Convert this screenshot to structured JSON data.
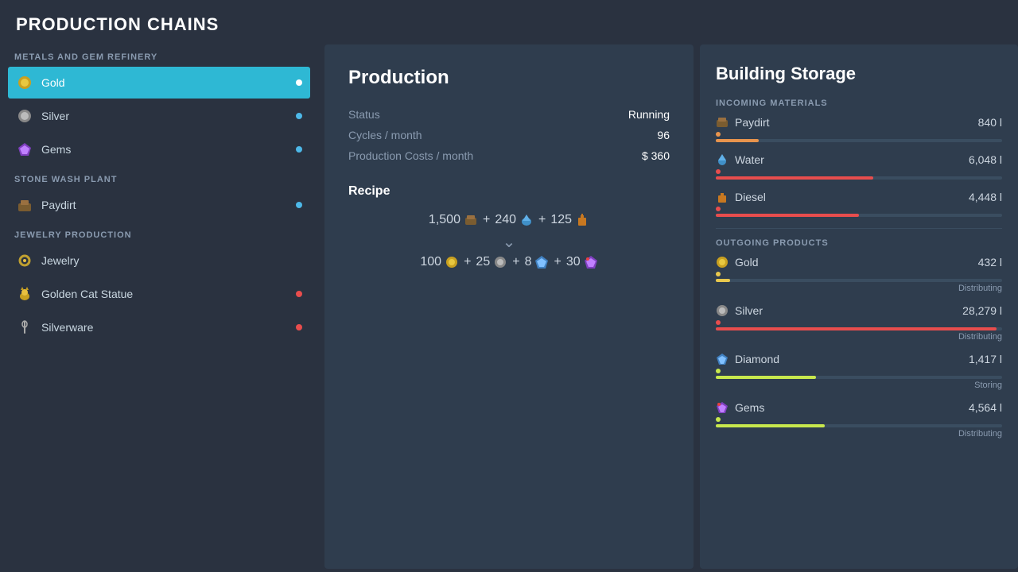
{
  "page": {
    "title": "PRODUCTION CHAINS"
  },
  "leftPanel": {
    "sections": [
      {
        "header": "METALS AND GEM REFINERY",
        "items": [
          {
            "id": "gold",
            "label": "Gold",
            "icon": "⛏️",
            "dot": "white",
            "active": true
          },
          {
            "id": "silver",
            "label": "Silver",
            "icon": "⛏️",
            "dot": "blue",
            "active": false
          },
          {
            "id": "gems",
            "label": "Gems",
            "icon": "💎",
            "dot": "blue",
            "active": false
          }
        ]
      },
      {
        "header": "STONE WASH PLANT",
        "items": [
          {
            "id": "paydirt",
            "label": "Paydirt",
            "icon": "🪨",
            "dot": "blue",
            "active": false
          }
        ]
      },
      {
        "header": "JEWELRY PRODUCTION",
        "items": [
          {
            "id": "jewelry",
            "label": "Jewelry",
            "icon": "💍",
            "dot": "none",
            "active": false
          },
          {
            "id": "golden-cat",
            "label": "Golden Cat Statue",
            "icon": "🐱",
            "dot": "red",
            "active": false
          },
          {
            "id": "silverware",
            "label": "Silverware",
            "icon": "🍴",
            "dot": "red",
            "active": false
          }
        ]
      }
    ]
  },
  "middlePanel": {
    "title": "Production",
    "status_label": "Status",
    "status_value": "Running",
    "cycles_label": "Cycles / month",
    "cycles_value": "96",
    "costs_label": "Production Costs / month",
    "costs_value": "$ 360",
    "recipe_title": "Recipe",
    "inputs": "1,500 🟤 + 240 💧 + 125 ⛽",
    "outputs": "100 🟡 + 25 ⬜ + 8 💎 + 30 💠"
  },
  "rightPanel": {
    "title": "Building Storage",
    "incoming_header": "INCOMING MATERIALS",
    "incoming": [
      {
        "name": "Paydirt",
        "amount": "840 l",
        "bar_pct": 15,
        "bar_color": "bar-orange",
        "status": ""
      },
      {
        "name": "Water",
        "amount": "6,048 l",
        "bar_pct": 55,
        "bar_color": "bar-red",
        "status": ""
      },
      {
        "name": "Diesel",
        "amount": "4,448 l",
        "bar_pct": 50,
        "bar_color": "bar-red",
        "status": ""
      }
    ],
    "outgoing_header": "OUTGOING PRODUCTS",
    "outgoing": [
      {
        "name": "Gold",
        "amount": "432 l",
        "bar_pct": 5,
        "bar_color": "bar-gold",
        "status": "Distributing"
      },
      {
        "name": "Silver",
        "amount": "28,279 l",
        "bar_pct": 98,
        "bar_color": "bar-red",
        "status": "Distributing"
      },
      {
        "name": "Diamond",
        "amount": "1,417 l",
        "bar_pct": 35,
        "bar_color": "bar-yellow",
        "status": "Storing"
      },
      {
        "name": "Gems",
        "amount": "4,564 l",
        "bar_pct": 38,
        "bar_color": "bar-yellow",
        "status": "Distributing"
      }
    ]
  }
}
